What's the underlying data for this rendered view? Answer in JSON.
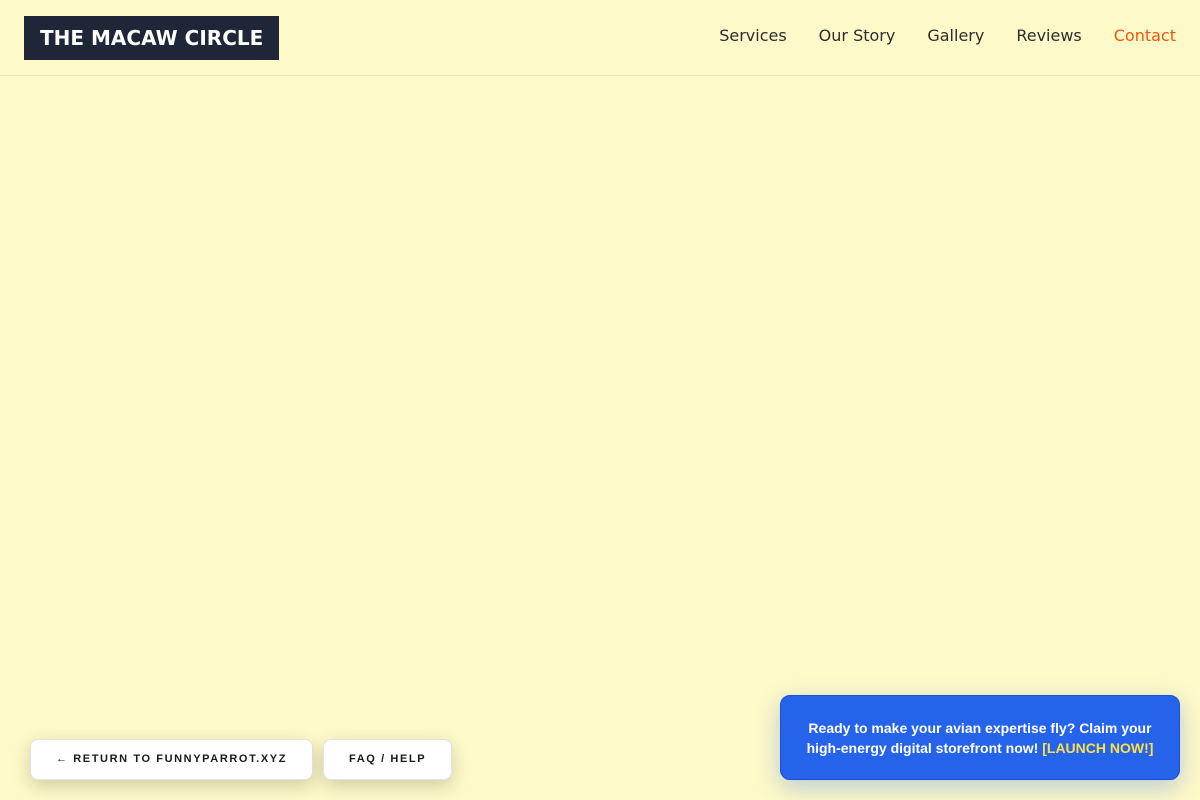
{
  "header": {
    "logo_text": "THE MACAW CIRCLE",
    "nav": [
      {
        "label": "Services"
      },
      {
        "label": "Our Story"
      },
      {
        "label": "Gallery"
      },
      {
        "label": "Reviews"
      },
      {
        "label": "Contact",
        "active": true
      }
    ]
  },
  "footer_buttons": {
    "return_label": "← RETURN TO FUNNYPARROT.XYZ",
    "faq_label": "FAQ / HELP"
  },
  "cta_banner": {
    "message": "Ready to make your avian expertise fly? Claim your high-energy digital storefront now!",
    "link_label": "[LAUNCH NOW!]"
  },
  "colors": {
    "background": "#fef9c8",
    "logo_bg": "#1e2638",
    "nav_active": "#ea580c",
    "cta_bg": "#2563eb",
    "cta_link": "#fde047"
  }
}
